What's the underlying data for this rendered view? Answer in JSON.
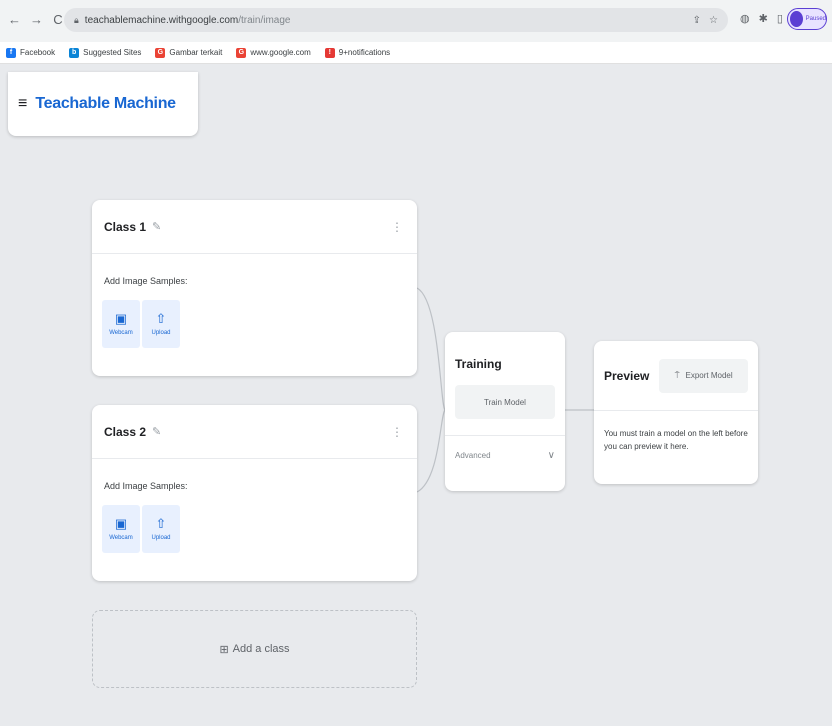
{
  "browser": {
    "url_host": "teachablemachine.withgoogle.com",
    "url_path": "/train/image",
    "profile_status": "Paused",
    "bookmarks": [
      {
        "label": "Facebook",
        "icon": "facebook-icon",
        "color": "#1877f2"
      },
      {
        "label": "Suggested Sites",
        "icon": "bing-icon",
        "color": "#0a84d6"
      },
      {
        "label": "Gambar terkait",
        "icon": "google-icon",
        "color": "#ea4335"
      },
      {
        "label": "www.google.com",
        "icon": "google-icon",
        "color": "#ea4335"
      },
      {
        "label": "9+notifications",
        "icon": "notification-icon",
        "color": "#e53935"
      }
    ]
  },
  "app": {
    "title": "Teachable Machine",
    "accent_color": "#1967d2"
  },
  "classes": [
    {
      "name": "Class 1",
      "samples_label": "Add Image Samples:",
      "webcam_label": "Webcam",
      "upload_label": "Upload"
    },
    {
      "name": "Class 2",
      "samples_label": "Add Image Samples:",
      "webcam_label": "Webcam",
      "upload_label": "Upload"
    }
  ],
  "add_class_label": "Add a class",
  "training": {
    "title": "Training",
    "train_button": "Train Model",
    "advanced_label": "Advanced"
  },
  "preview": {
    "title": "Preview",
    "export_button": "Export Model",
    "message": "You must train a model on the left before you can preview it here."
  }
}
